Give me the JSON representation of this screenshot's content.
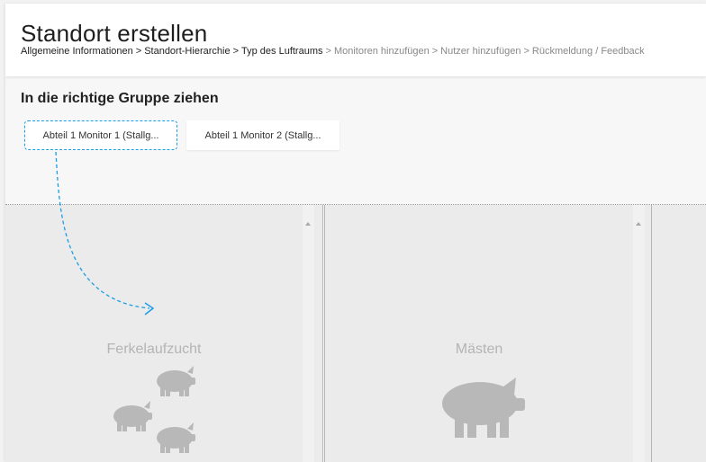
{
  "header": {
    "title": "Standort erstellen",
    "breadcrumb": {
      "done": [
        "Allgemeine Informationen",
        "Standort-Hierarchie",
        "Typ des Luftraums"
      ],
      "pending": [
        "Monitoren hinzufügen",
        "Nutzer hinzufügen",
        "Rückmeldung / Feedback"
      ],
      "separator": ">"
    }
  },
  "section": {
    "title": "In die richtige Gruppe ziehen"
  },
  "chips": [
    {
      "label": "Abteil 1 Monitor 1 (Stallg..."
    },
    {
      "label": "Abteil 1 Monitor 2 (Stallg..."
    }
  ],
  "groups": [
    {
      "label": "Ferkelaufzucht",
      "icon": "piglets-icon"
    },
    {
      "label": "Mästen",
      "icon": "pig-icon"
    }
  ],
  "colors": {
    "accent": "#1a9ee8",
    "pig_icon": "#b8b8b8",
    "group_label": "#b4b4b4"
  }
}
